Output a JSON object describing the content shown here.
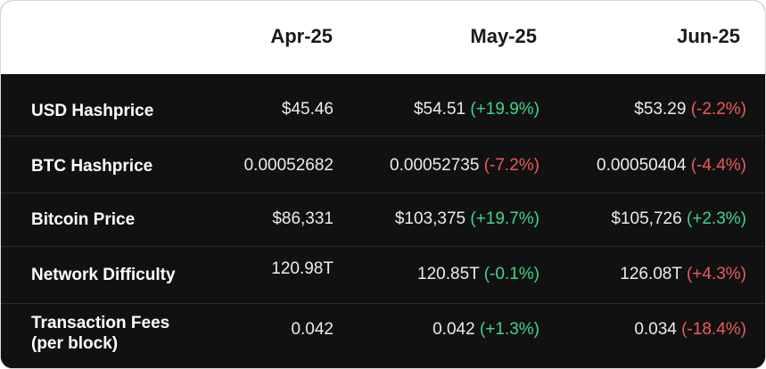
{
  "columns": [
    "Apr-25",
    "May-25",
    "Jun-25"
  ],
  "rows": [
    {
      "label": "USD Hashprice",
      "label_line2": "",
      "values": [
        {
          "value": "$45.46",
          "change": "",
          "direction": ""
        },
        {
          "value": "$54.51",
          "change": "(+19.9%)",
          "direction": "pos"
        },
        {
          "value": "$53.29",
          "change": "(-2.2%)",
          "direction": "neg"
        }
      ]
    },
    {
      "label": "BTC Hashprice",
      "label_line2": "",
      "values": [
        {
          "value": "0.00052682",
          "change": "",
          "direction": ""
        },
        {
          "value": "0.00052735",
          "change": "(-7.2%)",
          "direction": "neg"
        },
        {
          "value": "0.00050404",
          "change": "(-4.4%)",
          "direction": "neg"
        }
      ]
    },
    {
      "label": "Bitcoin Price",
      "label_line2": "",
      "values": [
        {
          "value": "$86,331",
          "change": "",
          "direction": ""
        },
        {
          "value": "$103,375",
          "change": "(+19.7%)",
          "direction": "pos"
        },
        {
          "value": "$105,726",
          "change": "(+2.3%)",
          "direction": "pos"
        }
      ]
    },
    {
      "label": "Network Difficulty",
      "label_line2": "",
      "values": [
        {
          "value": "120.98T",
          "change": "",
          "direction": ""
        },
        {
          "value": "120.85T",
          "change": "(-0.1%)",
          "direction": "pos"
        },
        {
          "value": "126.08T",
          "change": "(+4.3%)",
          "direction": "neg"
        }
      ]
    },
    {
      "label": "Transaction Fees",
      "label_line2": "(per block)",
      "values": [
        {
          "value": "0.042",
          "change": "",
          "direction": ""
        },
        {
          "value": "0.042",
          "change": "(+1.3%)",
          "direction": "pos"
        },
        {
          "value": "0.034",
          "change": "(-18.4%)",
          "direction": "neg"
        }
      ]
    }
  ],
  "colors": {
    "positive": "#3fd68a",
    "negative": "#f05a5a",
    "table_bg": "#111111",
    "header_bg": "#ffffff"
  }
}
